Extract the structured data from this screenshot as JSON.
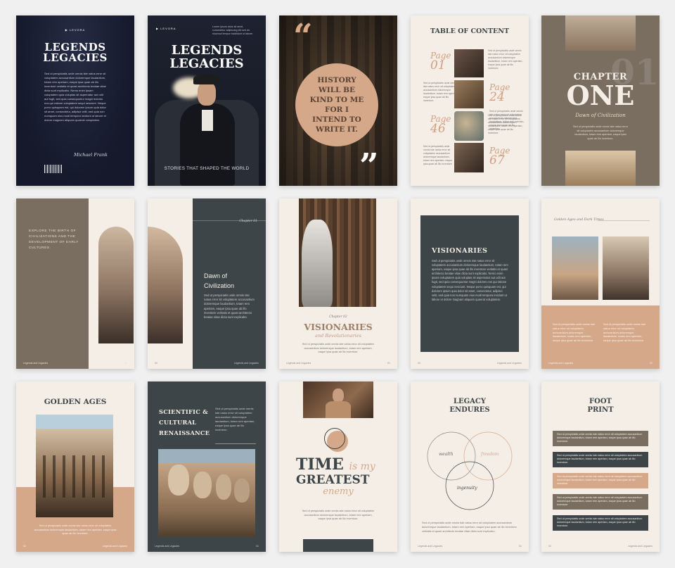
{
  "colors": {
    "navy": "#15192b",
    "slate": "#3d4548",
    "taupe": "#7a6e61",
    "cream": "#f4eee6",
    "peach": "#d6a88a",
    "rust": "#c49a82"
  },
  "brand": {
    "logo_text": "LEVORA"
  },
  "lorem": {
    "long": "Sed ut perspiciatis unde omnis iste natus error sit voluptatem accusantium doloremque laudantium, totam rem aperiam, eaque ipsa quae ab illo inventore veritatis et quasi architecto beatae vitae dicta sunt explicabo. Nemo enim ipsam voluptatem quia voluptas sit aspernatur aut odit aut fugit, sed quia consequuntur magni dolores eos qui ratione voluptatem sequi nesciunt. Neque porro quisquam est, qui dolorem ipsum quia dolor sit amet, consectetur, adipisci velit, sed quia non numquam eius modi tempora incidunt ut labore et dolore magnam aliquam quaerat voluptatem.",
    "short": "Sed ut perspiciatis unde omnis iste natus error sit voluptatem accusantium doloremque laudantium, totam rem aperiam, eaque ipsa quae ab illo inventore veritatis et quasi architecto beatae vitae dicta sunt explicabo.",
    "tiny": "Sed ut perspiciatis unde omnis iste natus error sit voluptatem accusantium doloremque laudantium, totam rem aperiam, eaque ipsa quae ab illo inventore."
  },
  "footer": {
    "left": "Legends and Legacies",
    "p1": "01",
    "p2": "02"
  },
  "p1": {
    "title1": "LEGENDS",
    "title2": "LEGACIES",
    "signature": "Michael Frank"
  },
  "p2": {
    "title1": "LEGENDS",
    "title2": "LEGACIES",
    "subtitle": "STORIES THAT SHAPED THE WORLD",
    "top_text": "Lorem ipsum dolor sit amet, consectetur adipiscing elit sed do eiusmod tempor incididunt ut labore."
  },
  "p3": {
    "quote": "HISTORY WILL BE KIND TO ME FOR I INTEND TO WRITE IT."
  },
  "p4": {
    "title": "TABLE OF CONTENT",
    "entries": [
      {
        "label": "Page",
        "num": "01"
      },
      {
        "label": "Page",
        "num": "24"
      },
      {
        "label": "Page",
        "num": "46"
      },
      {
        "label": "Page",
        "num": "67"
      }
    ]
  },
  "p5": {
    "chapter": "CHAPTER",
    "one": "ONE",
    "num": "01",
    "sub": "Dawn of Civilization"
  },
  "p6": {
    "text": "EXPLORE THE BIRTH OF CIVILIZATIONS AND THE DEVELOPMENT OF EARLY CULTURES."
  },
  "p7": {
    "chapter": "Chapter 01",
    "title1": "Dawn of",
    "title2": "Civilization"
  },
  "p8": {
    "chapter": "Chapter 02",
    "title": "VISIONARIES",
    "sub": "and Revolutionaries"
  },
  "p9": {
    "title": "VISIONARIES"
  },
  "p10": {
    "heading": "Golden Ages and Dark Times"
  },
  "p11": {
    "title": "GOLDEN AGES"
  },
  "p12": {
    "title1": "SCIENTIFIC &",
    "title2": "CULTURAL",
    "title3": "RENAISSANCE"
  },
  "p13": {
    "w1": "TIME",
    "w2": "is my",
    "w3": "GREATEST",
    "w4": "enemy"
  },
  "p14": {
    "title1": "LEGACY",
    "title2": "ENDURES",
    "c1": "wealth",
    "c2": "freedom",
    "c3": "ingenuity"
  },
  "p15": {
    "title1": "FOOT",
    "title2": "PRINT"
  }
}
